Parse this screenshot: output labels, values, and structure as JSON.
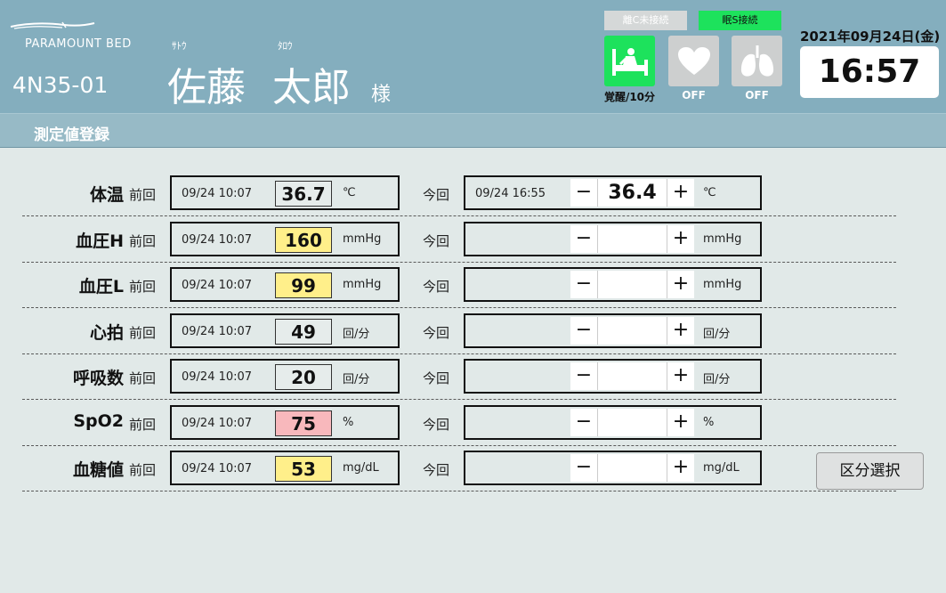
{
  "header": {
    "logo_text": "PARAMOUNT BED",
    "room": "4N35-01",
    "patient": {
      "last_kana": "ｻﾄｳ",
      "first_kana": "ﾀﾛｳ",
      "last_name": "佐藤",
      "first_name": "太郎",
      "honorific": "様"
    },
    "connections": [
      {
        "label": "離C未接続",
        "state": "disconnected",
        "color": "#d5d8d8"
      },
      {
        "label": "眠S接続",
        "state": "connected",
        "color": "#1de25c"
      }
    ],
    "status_icons": [
      {
        "icon": "bed-awake-icon",
        "label": "覚醒/10分",
        "active": true
      },
      {
        "icon": "heart-icon",
        "label": "OFF",
        "active": false
      },
      {
        "icon": "lungs-icon",
        "label": "OFF",
        "active": false
      }
    ],
    "date": "2021年09月24日(金)",
    "time": "16:57"
  },
  "subheader": {
    "title": "測定値登録"
  },
  "labels": {
    "previous": "前回",
    "current": "今回"
  },
  "measurements": [
    {
      "name": "体温",
      "prev_time": "09/24 10:07",
      "prev_value": "36.7",
      "prev_highlight": "none",
      "unit": "℃",
      "cur_time": "09/24 16:55",
      "cur_value": "36.4"
    },
    {
      "name": "血圧H",
      "prev_time": "09/24 10:07",
      "prev_value": "160",
      "prev_highlight": "yellow",
      "unit": "mmHg",
      "cur_time": "",
      "cur_value": ""
    },
    {
      "name": "血圧L",
      "prev_time": "09/24 10:07",
      "prev_value": "99",
      "prev_highlight": "yellow",
      "unit": "mmHg",
      "cur_time": "",
      "cur_value": ""
    },
    {
      "name": "心拍",
      "prev_time": "09/24 10:07",
      "prev_value": "49",
      "prev_highlight": "none",
      "unit": "回/分",
      "cur_time": "",
      "cur_value": ""
    },
    {
      "name": "呼吸数",
      "prev_time": "09/24 10:07",
      "prev_value": "20",
      "prev_highlight": "none",
      "unit": "回/分",
      "cur_time": "",
      "cur_value": ""
    },
    {
      "name": "SpO2",
      "prev_time": "09/24 10:07",
      "prev_value": "75",
      "prev_highlight": "pink",
      "unit": "%",
      "cur_time": "",
      "cur_value": ""
    },
    {
      "name": "血糖値",
      "prev_time": "09/24 10:07",
      "prev_value": "53",
      "prev_highlight": "yellow",
      "unit": "mg/dL",
      "cur_time": "",
      "cur_value": ""
    }
  ],
  "stepper": {
    "minus": "−",
    "plus": "+"
  },
  "select_button": "区分選択",
  "colors": {
    "header_bg": "#84aebe",
    "subbar_bg": "#97bac6",
    "page_bg": "#e1e9e8",
    "highlight_yellow": "#ffef8a",
    "highlight_pink": "#f8b8bc",
    "active_green": "#1de25c"
  }
}
